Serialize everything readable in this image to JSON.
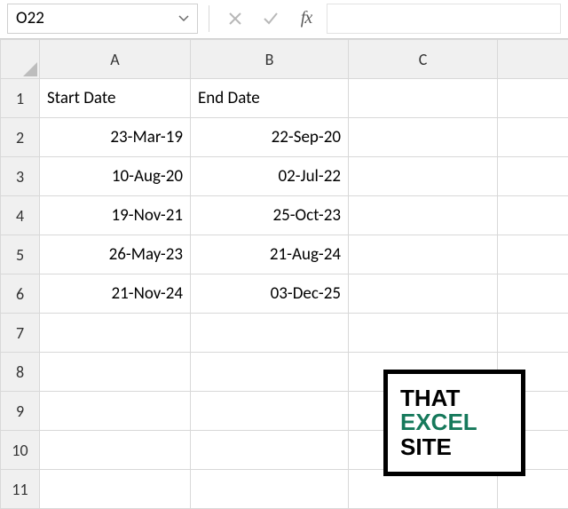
{
  "formula_bar": {
    "name_box_value": "O22",
    "cancel_tip": "Cancel",
    "enter_tip": "Enter",
    "fx_label": "fx",
    "formula_value": ""
  },
  "columns": [
    "A",
    "B",
    "C"
  ],
  "rows": [
    "1",
    "2",
    "3",
    "4",
    "5",
    "6",
    "7",
    "8",
    "9",
    "10",
    "11"
  ],
  "headers": {
    "A": "Start Date",
    "B": "End Date"
  },
  "data": {
    "A": [
      "23-Mar-19",
      "10-Aug-20",
      "19-Nov-21",
      "26-May-23",
      "21-Nov-24"
    ],
    "B": [
      "22-Sep-20",
      "02-Jul-22",
      "25-Oct-23",
      "21-Aug-24",
      "03-Dec-25"
    ]
  },
  "logo": {
    "line1": "THAT",
    "line2": "EXCEL",
    "line3": "SITE"
  }
}
